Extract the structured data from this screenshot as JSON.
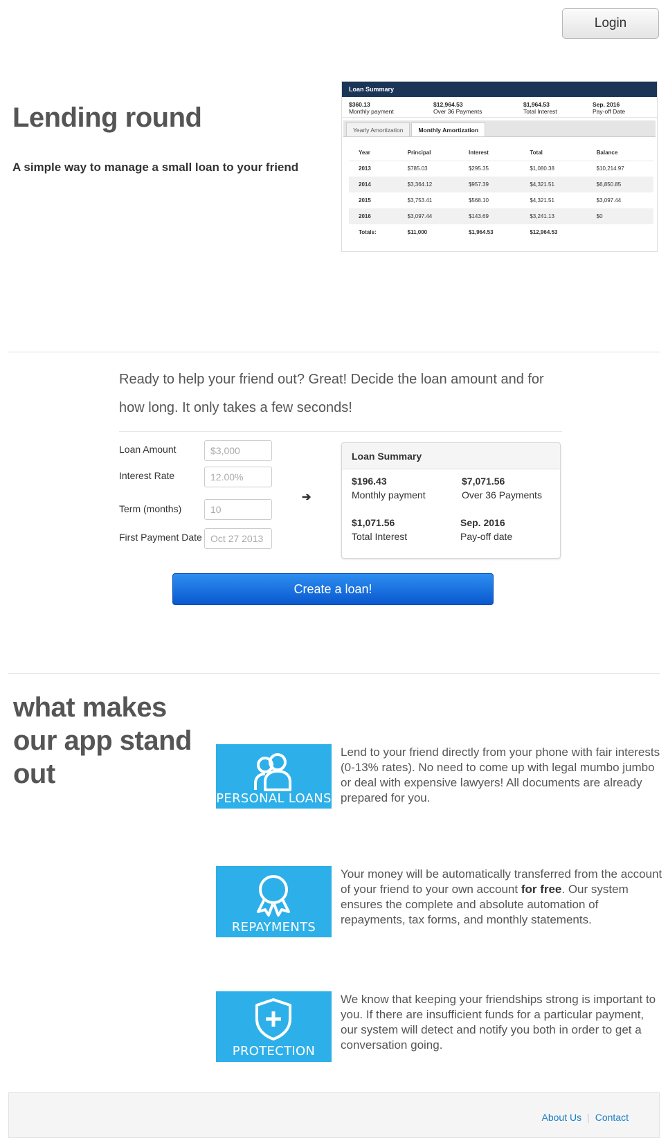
{
  "header": {
    "login_label": "Login"
  },
  "hero": {
    "title": "Lending round",
    "subtitle": "A simple way to manage a small loan to your friend"
  },
  "screenshot": {
    "head": "Loan Summary",
    "summary": [
      {
        "value": "$360.13",
        "label": "Monthly payment"
      },
      {
        "value": "$12,964.53",
        "label": "Over 36 Payments"
      },
      {
        "value": "$1,964.53",
        "label": "Total Interest"
      },
      {
        "value": "Sep. 2016",
        "label": "Pay-off Date"
      }
    ],
    "tabs": [
      "Yearly Amortization",
      "Monthly Amortization"
    ],
    "columns": [
      "Year",
      "Principal",
      "Interest",
      "Total",
      "Balance"
    ],
    "rows": [
      [
        "2013",
        "$785.03",
        "$295.35",
        "$1,080.38",
        "$10,214.97"
      ],
      [
        "2014",
        "$3,364.12",
        "$957.39",
        "$4,321.51",
        "$6,850.85"
      ],
      [
        "2015",
        "$3,753.41",
        "$568.10",
        "$4,321.51",
        "$3,097.44"
      ],
      [
        "2016",
        "$3,097.44",
        "$143.69",
        "$3,241.13",
        "$0"
      ]
    ],
    "totals": [
      "Totals:",
      "$11,000",
      "$1,964.53",
      "$12,964.53",
      ""
    ]
  },
  "intro": {
    "text": "Ready to help your friend out? Great! Decide the loan amount and for how long. It only takes a few seconds!"
  },
  "form": {
    "loan_amount": {
      "label": "Loan Amount",
      "placeholder": "$3,000"
    },
    "interest_rate": {
      "label": "Interest Rate",
      "placeholder": "12.00%"
    },
    "term": {
      "label": "Term (months)",
      "placeholder": "10"
    },
    "first_payment": {
      "label": "First Payment Date",
      "placeholder": "Oct 27 2013"
    },
    "arrow": "➔"
  },
  "summary": {
    "title": "Loan Summary",
    "monthly_value": "$196.43",
    "monthly_label": "Monthly payment",
    "total_value": "$7,071.56",
    "total_label": "Over 36 Payments",
    "interest_value": "$1,071.56",
    "interest_label": "Total Interest",
    "payoff_value": "Sep. 2016",
    "payoff_label": "Pay-off date"
  },
  "cta": {
    "create_label": "Create a loan!"
  },
  "features": {
    "title": "what makes our app stand out",
    "items": [
      {
        "icon": "users-icon",
        "label": "PERSONAL LOANS",
        "text": "Lend to your friend directly from your phone with fair interests (0-13% rates). No need to come up with legal mumbo jumbo or deal with expensive lawyers! All documents are already prepared for you."
      },
      {
        "icon": "ribbon-icon",
        "label": "REPAYMENTS",
        "text_before": "Your money will be automatically transferred from the account of your friend to your own account ",
        "text_bold": "for free",
        "text_after": ". Our system ensures the complete and absolute automation of repayments, tax forms, and monthly statements."
      },
      {
        "icon": "shield-plus-icon",
        "label": "PROTECTION",
        "text": "We know that keeping your friendships strong is important to you. If there are insufficient funds for a particular payment, our system will detect and notify you both in order to get a conversation going."
      }
    ],
    "icon_color": "#2db0e9"
  },
  "footer": {
    "about": "About Us",
    "contact": "Contact"
  }
}
